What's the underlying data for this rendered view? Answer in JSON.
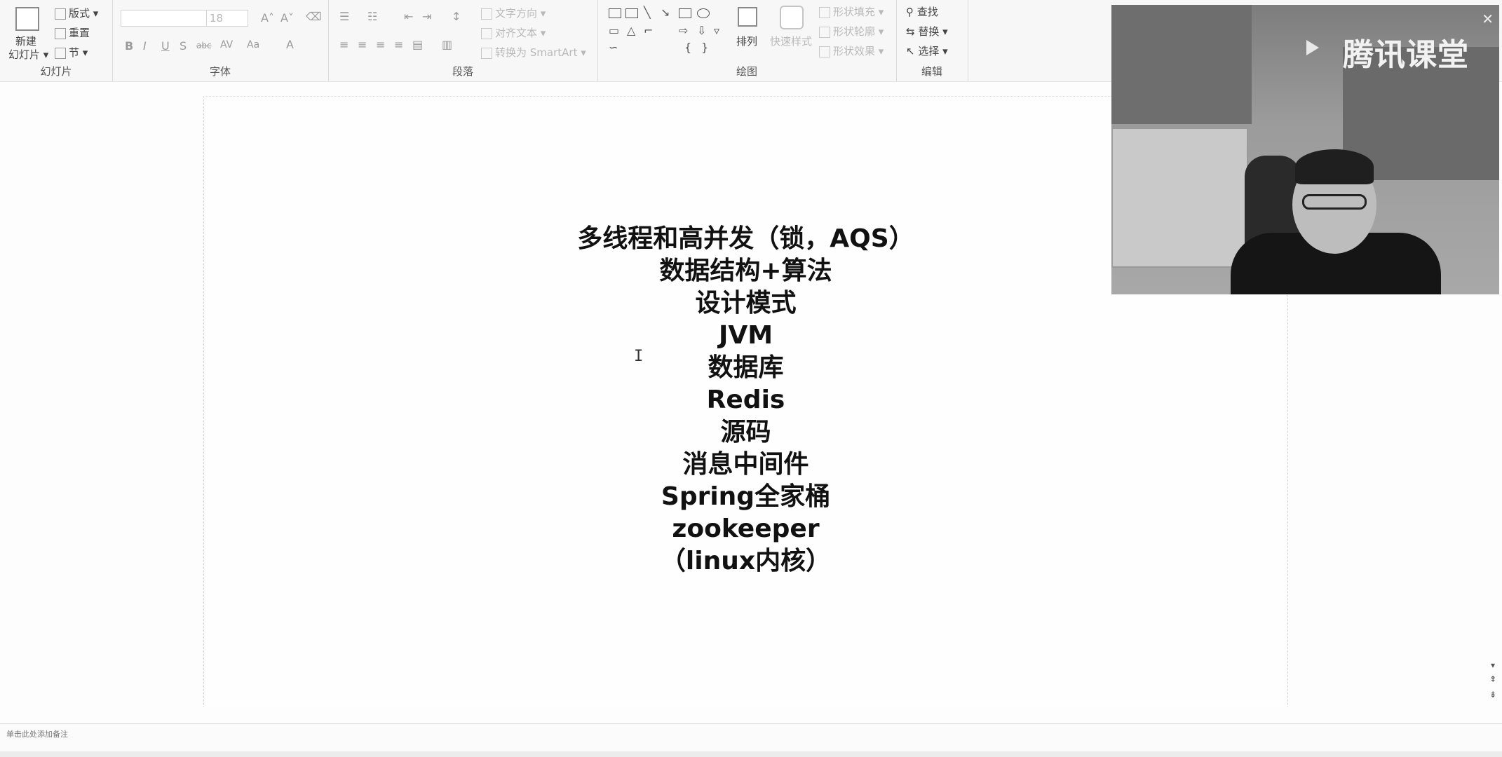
{
  "ribbon": {
    "slides_group": {
      "label": "幻灯片",
      "new_slide_line1": "新建",
      "new_slide_line2": "幻灯片 ▾",
      "layout": "版式 ▾",
      "reset": "重置",
      "section": "节 ▾"
    },
    "font_group": {
      "label": "字体",
      "font_name": "",
      "font_size": "18",
      "bold": "B",
      "italic": "I",
      "underline": "U",
      "shadow": "S",
      "strike": "abc",
      "spacing": "AV",
      "case": "Aa",
      "font_color": "A",
      "grow": "A˄",
      "shrink": "A˅"
    },
    "paragraph_group": {
      "label": "段落",
      "text_direction": "文字方向 ▾",
      "align_text": "对齐文本 ▾",
      "smartart": "转换为 SmartArt ▾"
    },
    "drawing_group": {
      "label": "绘图",
      "arrange": "排列",
      "quick_styles": "快速样式",
      "shape_fill": "形状填充 ▾",
      "shape_outline": "形状轮廓 ▾",
      "shape_effects": "形状效果 ▾"
    },
    "editing_group": {
      "label": "编辑",
      "find": "查找",
      "replace": "替换 ▾",
      "select": "选择 ▾"
    }
  },
  "slide": {
    "lines": [
      "多线程和高并发（锁，AQS）",
      "数据结构+算法",
      "设计模式",
      "JVM",
      "数据库",
      "Redis",
      "源码",
      "消息中间件",
      "Spring全家桶",
      "zookeeper",
      "（linux内核）"
    ]
  },
  "webcam": {
    "logo_text": "腾讯课堂",
    "close": "✕"
  },
  "notes": {
    "placeholder": "单击此处添加备注"
  }
}
